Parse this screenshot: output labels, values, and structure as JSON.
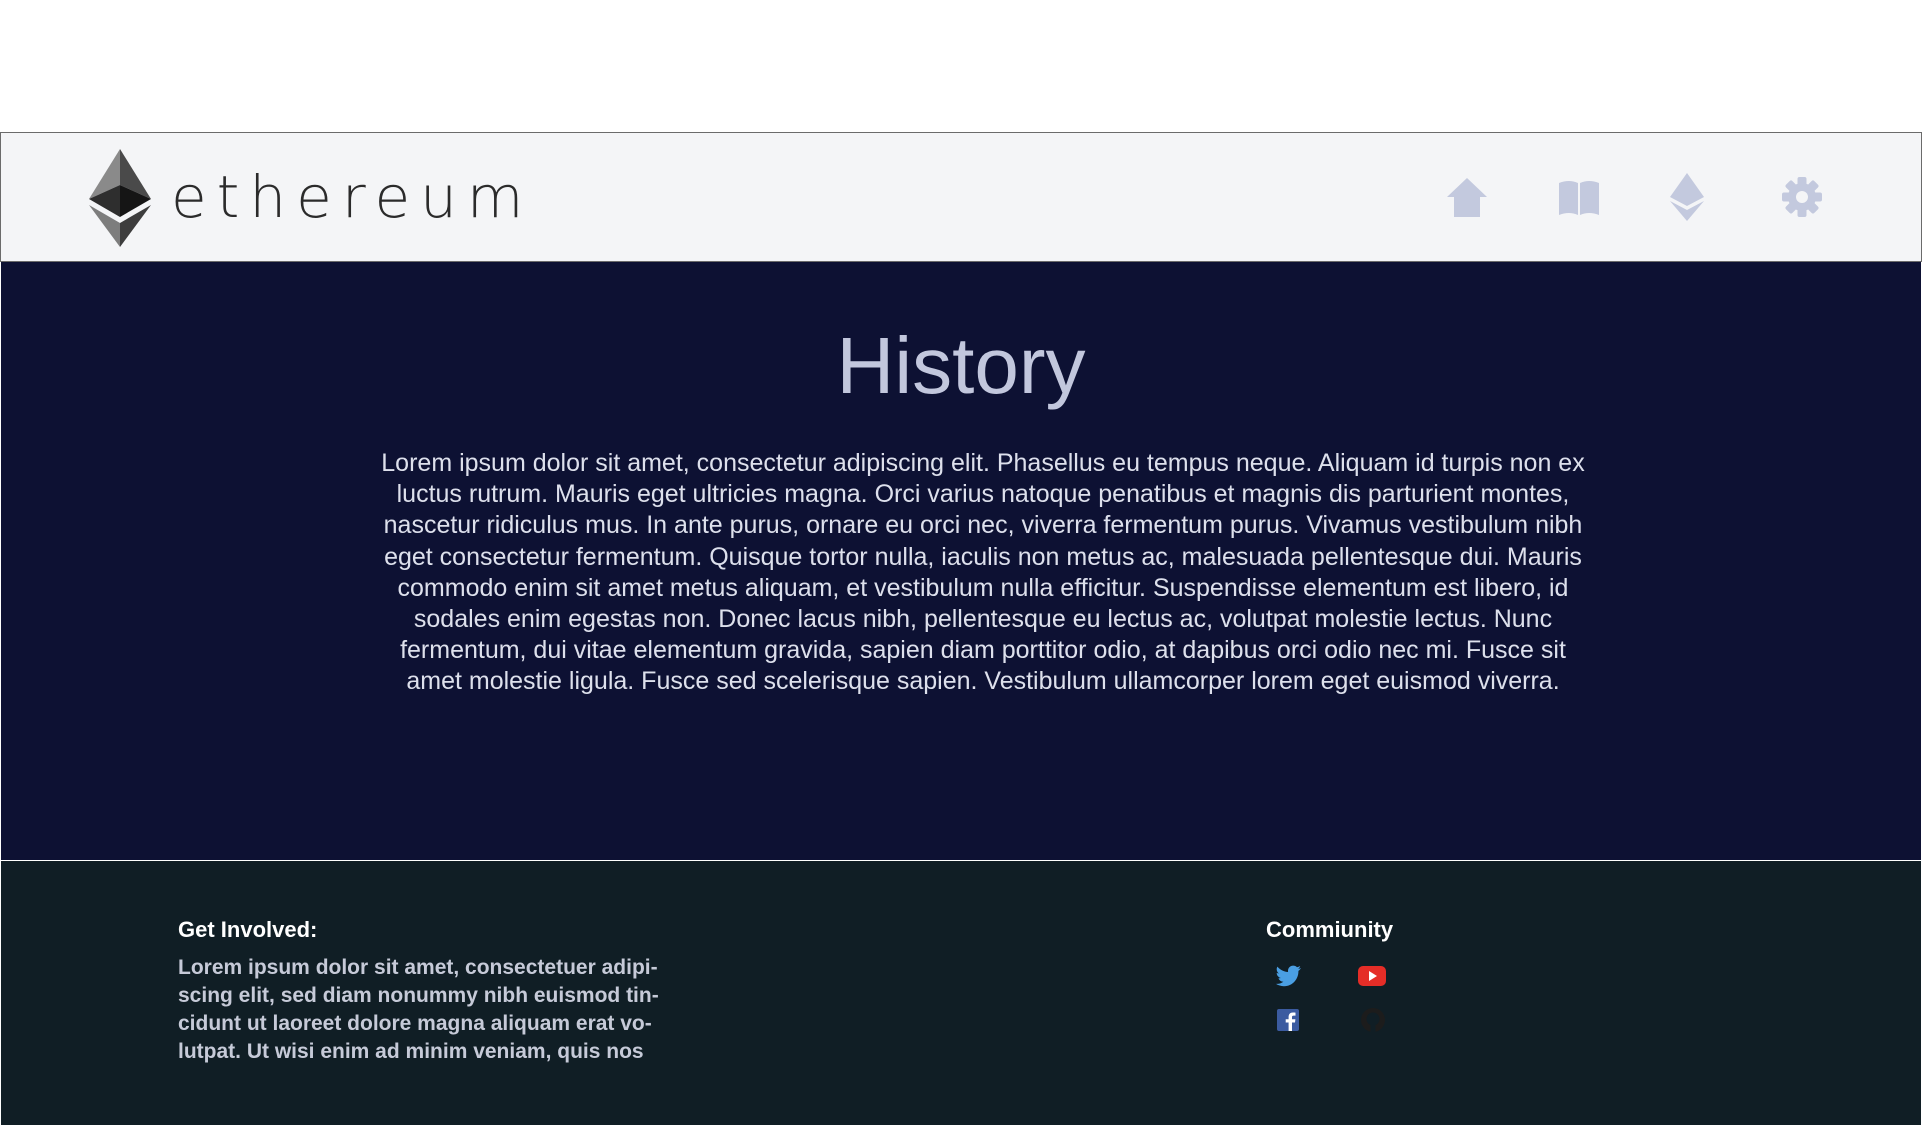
{
  "brand": {
    "name": "ethereum",
    "logo_icon": "ethereum-diamond-icon"
  },
  "nav": {
    "items": [
      {
        "icon": "home-icon",
        "label": "Home"
      },
      {
        "icon": "book-icon",
        "label": "Docs"
      },
      {
        "icon": "ether-icon",
        "label": "Ether"
      },
      {
        "icon": "gear-icon",
        "label": "Settings"
      }
    ],
    "icon_color": "#c3c9de"
  },
  "hero": {
    "title": "History",
    "body": "Lorem ipsum dolor sit amet, consectetur adipiscing elit. Phasellus eu tempus neque. Aliquam id turpis non ex luctus rutrum. Mauris eget ultricies magna. Orci varius natoque penatibus et magnis dis parturient montes, nascetur ridiculus mus. In ante purus, ornare eu orci nec, viverra fermentum purus. Vivamus vestib­ulum nibh eget consectetur fermentum. Quisque tortor nulla, iaculis non metus ac, malesuada pellentesque dui. Mauris commodo enim sit amet metus aliquam, et vestibulum nulla efficitur. Suspendisse elementum est libero, id sodales enim egestas non. Donec lacus nibh, pellentesque eu lectus ac, volutpat molestie lectus. Nunc fermentum, dui vitae elementum gravida, sapien diam porttitor odio, at dapibus orci odio nec mi. Fusce sit amet molestie ligula. Fusce sed scelerisque sapien. Vestibulum ullamcorper lorem eget euis­mod viverra.",
    "background": "#0d1133"
  },
  "footer": {
    "involved": {
      "heading": "Get Involved:",
      "text": "Lorem ipsum dolor sit amet, consectetuer adipi­scing elit, sed diam nonummy nibh euismod tin­cidunt ut laoreet dolore magna aliquam erat vo­lutpat. Ut wisi enim ad minim veniam, quis nos­"
    },
    "community": {
      "heading": "Commiunity",
      "links": [
        {
          "icon": "twitter-icon",
          "color": "#4a9fe3"
        },
        {
          "icon": "youtube-icon",
          "color": "#e52d27"
        },
        {
          "icon": "facebook-icon",
          "color": "#3b5ba0"
        },
        {
          "icon": "github-icon",
          "color": "#1c1c1c"
        }
      ]
    },
    "background": "#101e25"
  }
}
